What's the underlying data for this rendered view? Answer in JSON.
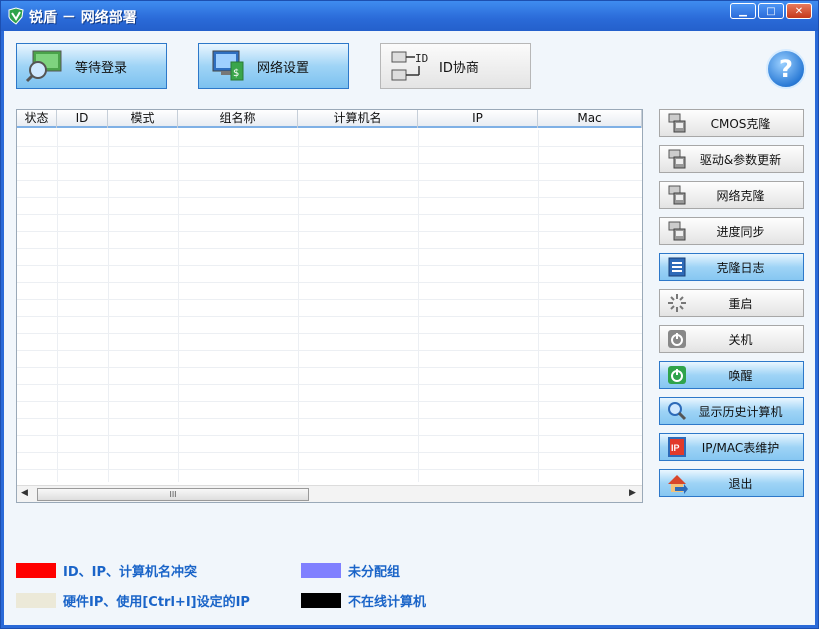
{
  "window": {
    "title": "锐盾 － 网络部署"
  },
  "toolbar": {
    "wait_login": "等待登录",
    "network_settings": "网络设置",
    "id_negotiate": "ID协商",
    "id_icon_text": "ID",
    "help": "?"
  },
  "table": {
    "columns": [
      "状态",
      "ID",
      "模式",
      "组名称",
      "计算机名",
      "IP",
      "Mac"
    ],
    "rows": [],
    "scroll_thumb": "III"
  },
  "side_buttons": [
    {
      "label": "CMOS克隆",
      "icon": "computer-icon"
    },
    {
      "label": "驱动&参数更新",
      "icon": "computer-icon"
    },
    {
      "label": "网络克隆",
      "icon": "computer-icon"
    },
    {
      "label": "进度同步",
      "icon": "computer-icon"
    },
    {
      "label": "克隆日志",
      "icon": "log-icon"
    },
    {
      "label": "重启",
      "icon": "restart-icon"
    },
    {
      "label": "关机",
      "icon": "shutdown-icon"
    },
    {
      "label": "唤醒",
      "icon": "power-icon"
    },
    {
      "label": "显示历史计算机",
      "icon": "search-icon"
    },
    {
      "label": "IP/MAC表维护",
      "icon": "ip-icon"
    },
    {
      "label": "退出",
      "icon": "exit-icon"
    }
  ],
  "legend": [
    {
      "color": "#ff0000",
      "text": "ID、IP、计算机名冲突"
    },
    {
      "color": "#8080ff",
      "text": "未分配组"
    },
    {
      "color": "#ece9d8",
      "text": "硬件IP、使用[Ctrl+I]设定的IP"
    },
    {
      "color": "#000000",
      "text": "不在线计算机"
    }
  ],
  "ip_icon_text": "IP"
}
